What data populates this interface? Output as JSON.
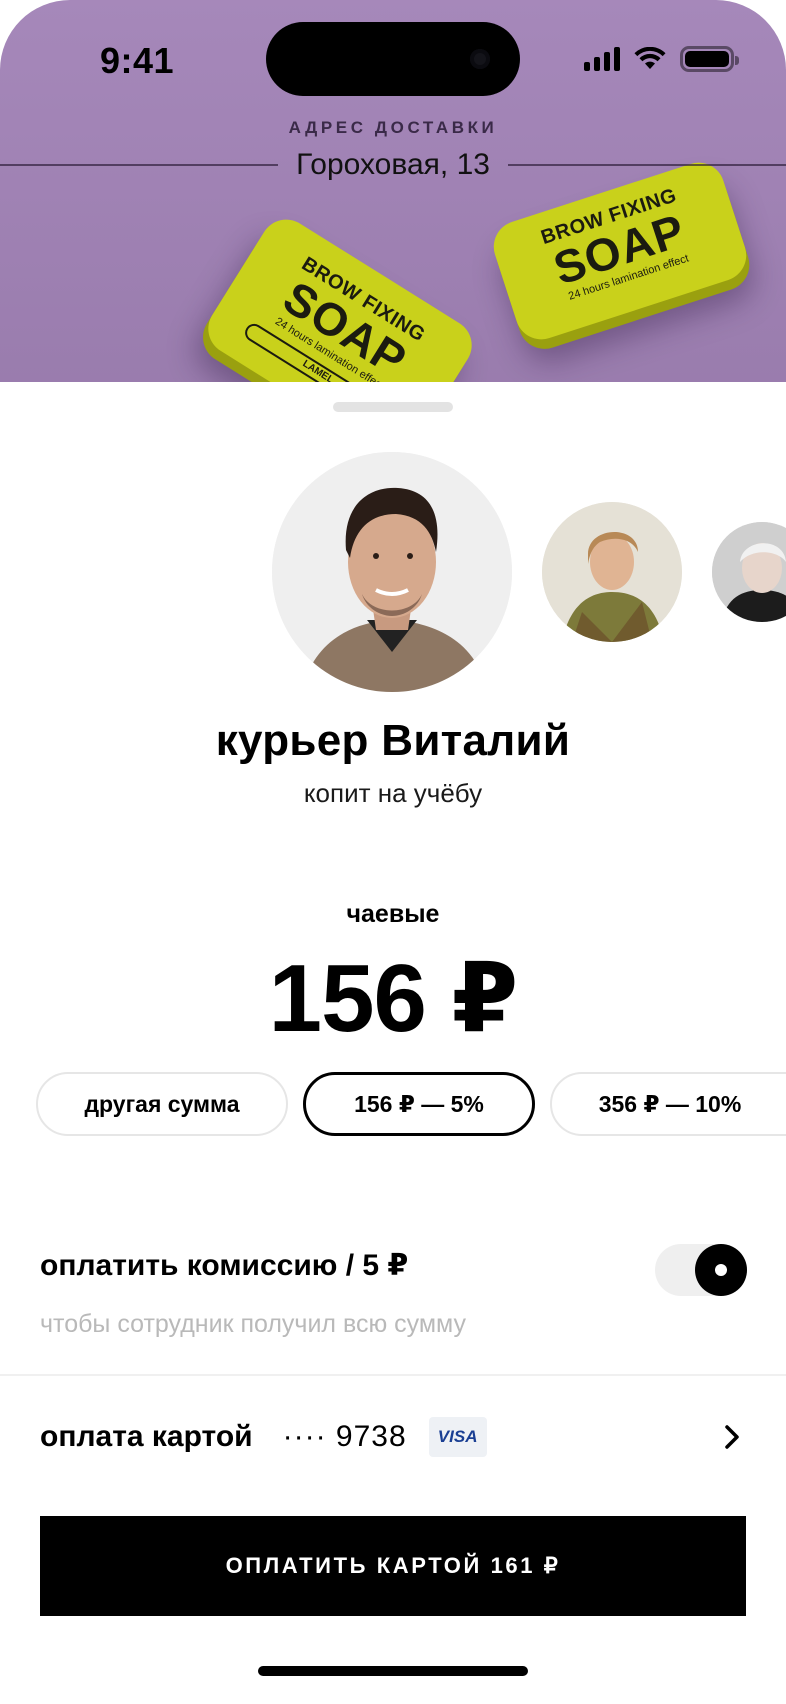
{
  "status_bar": {
    "time": "9:41",
    "icons": [
      "cellular-signal-icon",
      "wifi-icon",
      "battery-icon"
    ]
  },
  "delivery": {
    "label": "АДРЕС ДОСТАВКИ",
    "address": "Гороховая, 13"
  },
  "hero": {
    "background_color": "#a283b7",
    "product_tin": {
      "line1": "BROW FIXING",
      "line2": "SOAP",
      "line3": "24 hours lamination effect",
      "line4": "LAMEL"
    }
  },
  "courier": {
    "name": "курьер Виталий",
    "note": "копит на учёбу"
  },
  "tip": {
    "label": "чаевые",
    "amount": "156 ₽",
    "options": [
      {
        "label": "другая сумма",
        "selected": false
      },
      {
        "label": "156 ₽  —  5%",
        "selected": true
      },
      {
        "label": "356 ₽  —  10%",
        "selected": false
      }
    ]
  },
  "fee": {
    "title": "оплатить комиссию  / 5 ₽",
    "subtitle": "чтобы сотрудник получил всю сумму",
    "enabled": true
  },
  "payment": {
    "label": "оплата картой",
    "card_mask": "···· 9738",
    "card_brand": "VISA"
  },
  "pay_button": {
    "label": "ОПЛАТИТЬ КАРТОЙ 161 ₽"
  },
  "colors": {
    "accent": "#000000",
    "muted_text": "#b9b9b9",
    "chip_border": "#e6e6e6",
    "tin_yellow": "#c9d11b",
    "visa_blue": "#1a3f93"
  }
}
